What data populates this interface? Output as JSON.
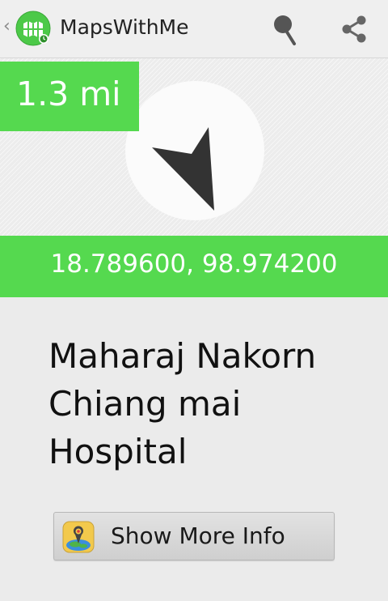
{
  "action_bar": {
    "title": "MapsWithMe",
    "up_caret": "‹",
    "icons": {
      "app": "mapswithme-app-icon",
      "pin": "map-pin-icon",
      "share": "share-icon"
    }
  },
  "compass": {
    "distance": "1.3 mi",
    "arrow_icon": "direction-arrow-icon"
  },
  "coordinates": "18.789600, 98.974200",
  "place": {
    "line1": "Maharaj Nakorn",
    "line2": "Chiang mai",
    "line3": "Hospital"
  },
  "more_button": {
    "label": "Show More Info",
    "icon": "globe-pin-icon"
  },
  "colors": {
    "accent_green": "#55d94f",
    "background": "#ebebeb",
    "arrow": "#333333"
  }
}
